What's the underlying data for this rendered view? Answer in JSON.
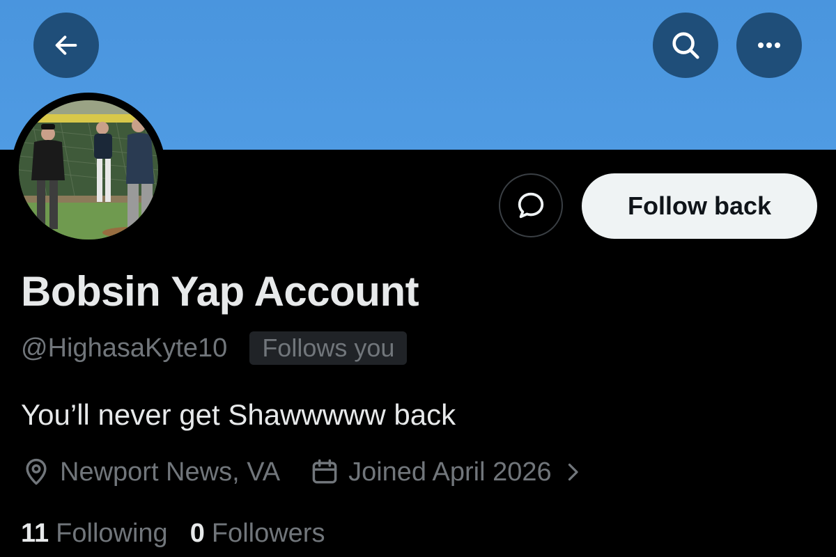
{
  "header": {
    "back_icon": "arrow-left-icon",
    "search_icon": "search-icon",
    "more_icon": "more-horizontal-icon",
    "banner_color": "#4f9be3",
    "button_bg_color": "#1f4e79"
  },
  "profile": {
    "avatar_description": "avatar-photo",
    "display_name": "Bobsin Yap Account",
    "handle": "@HighasaKyte10",
    "follows_you_label": "Follows you",
    "bio": "You’ll never get Shawwwww back",
    "location": "Newport News, VA",
    "joined": "Joined April 2026",
    "following_count": "11",
    "following_label": "Following",
    "followers_count": "0",
    "followers_label": "Followers"
  },
  "actions": {
    "message_icon": "message-bubble-icon",
    "follow_back_label": "Follow back"
  },
  "colors": {
    "background": "#000000",
    "primary_text": "#e7e9ea",
    "secondary_text": "#71767b",
    "follow_button_bg": "#eff3f4"
  }
}
